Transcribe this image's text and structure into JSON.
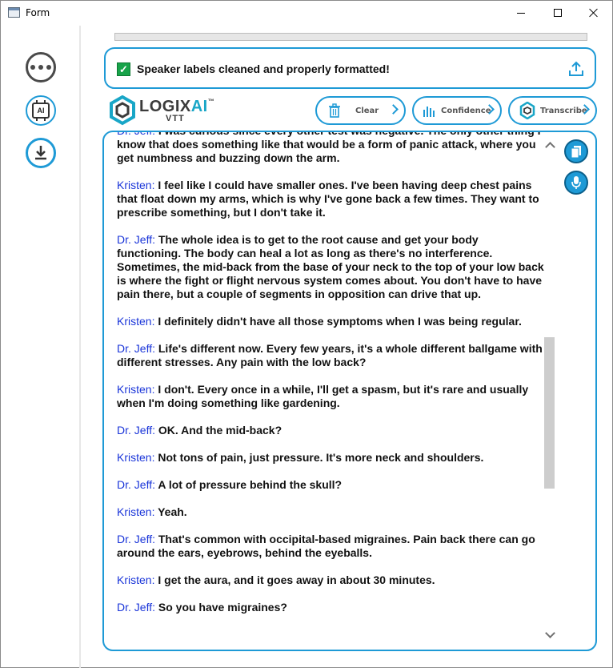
{
  "window": {
    "title": "Form"
  },
  "status": {
    "message": "Speaker labels cleaned and properly formatted!"
  },
  "progress": {
    "fraction": 0.0
  },
  "logo": {
    "word_main": "LOGIX",
    "word_ai": "AI",
    "tm": "™",
    "sub": "VTT"
  },
  "actions": {
    "clear": "Clear",
    "confidence": "Confidence",
    "transcribe": "Transcribe"
  },
  "icons": {
    "more": "more-icon",
    "ai": "ai-chip-icon",
    "download": "download-icon",
    "upload": "upload-icon",
    "copy": "copy-icon",
    "mic": "mic-icon",
    "trash": "trash-icon",
    "levels": "levels-icon",
    "logo": "logo-icon"
  },
  "colors": {
    "accent": "#1e9ad6",
    "speaker": "#1a35d9",
    "success": "#18a34a"
  },
  "transcript": [
    {
      "speaker": "Dr. Jeff:",
      "text": " I was curious since every other test was negative. The only other thing I know that does something like that would be a form of panic attack, where you get numbness and buzzing down the arm."
    },
    {
      "speaker": "Kristen:",
      "text": " I feel like I could have smaller ones. I've been having deep chest pains that float down my arms, which is why I've gone back a few times. They want to prescribe something, but I don't take it."
    },
    {
      "speaker": "Dr. Jeff:",
      "text": " The whole idea is to get to the root cause and get your body functioning. The body can heal a lot as long as there's no interference. Sometimes, the mid-back from the base of your neck to the top of your low back is where the fight or flight nervous system comes about. You don't have to have pain there, but a couple of segments in opposition can drive that up."
    },
    {
      "speaker": "Kristen:",
      "text": " I definitely didn't have all those symptoms when I was being regular."
    },
    {
      "speaker": "Dr. Jeff:",
      "text": " Life's different now. Every few years, it's a whole different ballgame with different stresses. Any pain with the low back?"
    },
    {
      "speaker": "Kristen:",
      "text": " I don't. Every once in a while, I'll get a spasm, but it's rare and usually when I'm doing something like gardening."
    },
    {
      "speaker": "Dr. Jeff:",
      "text": " OK. And the mid-back?"
    },
    {
      "speaker": "Kristen:",
      "text": " Not tons of pain, just pressure. It's more neck and shoulders."
    },
    {
      "speaker": "Dr. Jeff:",
      "text": " A lot of pressure behind the skull?"
    },
    {
      "speaker": "Kristen:",
      "text": " Yeah."
    },
    {
      "speaker": "Dr. Jeff:",
      "text": " That's common with occipital-based migraines. Pain back there can go around the ears, eyebrows, behind the eyeballs."
    },
    {
      "speaker": "Kristen:",
      "text": " I get the aura, and it goes away in about 30 minutes."
    },
    {
      "speaker": "Dr. Jeff:",
      "text": " So you have migraines?"
    }
  ]
}
